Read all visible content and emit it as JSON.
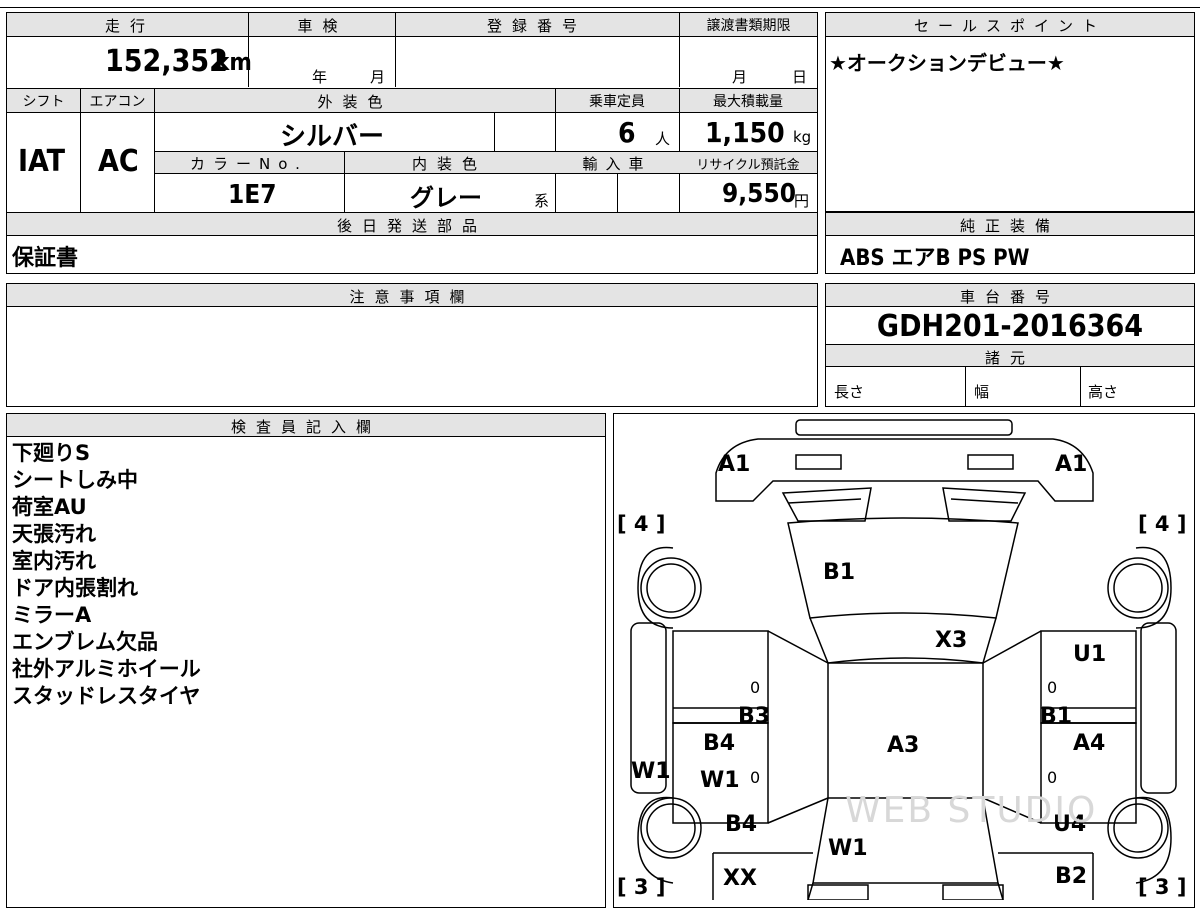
{
  "mileage": {
    "header": "走行",
    "value": "152,352",
    "unit": "km"
  },
  "shaken": {
    "header": "車検",
    "year_label": "年",
    "month_label": "月"
  },
  "registration": {
    "header": "登録番号",
    "value": ""
  },
  "transfer_deadline": {
    "header": "譲渡書類期限",
    "month_label": "月",
    "day_label": "日"
  },
  "sales_point": {
    "header": "セールスポイント",
    "text": "★オークションデビュー★"
  },
  "shift": {
    "header": "シフト",
    "value": "IAT"
  },
  "aircon": {
    "header": "エアコン",
    "value": "AC"
  },
  "exterior_color": {
    "header": "外装色",
    "value": "シルバー"
  },
  "capacity": {
    "header": "乗車定員",
    "value": "6",
    "unit": "人"
  },
  "max_load": {
    "header": "最大積載量",
    "value": "1,150",
    "unit": "kg"
  },
  "color_no": {
    "header": "カラーNo.",
    "value": "1E7"
  },
  "interior_color": {
    "header": "内装色",
    "value": "グレー",
    "suffix": "系"
  },
  "import": {
    "header": "輸入車",
    "value": ""
  },
  "recycle": {
    "header": "リサイクル預託金",
    "value": "9,550",
    "unit": "円"
  },
  "later_parts": {
    "header": "後日発送部品",
    "text": "保証書"
  },
  "genuine_equipment": {
    "header": "純正装備",
    "text": "ABS エアB PS PW"
  },
  "caution": {
    "header": "注意事項欄",
    "text": ""
  },
  "chassis": {
    "header": "車台番号",
    "value": "GDH201-2016364"
  },
  "specs": {
    "header": "諸元",
    "length_label": "長さ",
    "width_label": "幅",
    "height_label": "高さ"
  },
  "inspector": {
    "header": "検査員記入欄",
    "notes": [
      "下廻りS",
      "シートしみ中",
      "荷室AU",
      "天張汚れ",
      "室内汚れ",
      "ドア内張割れ",
      "ミラーA",
      "エンブレム欠品",
      "社外アルミホイール",
      "スタッドレスタイヤ"
    ]
  },
  "diagram": {
    "marks": {
      "a1_left": "A1",
      "a1_right": "A1",
      "tire_fl": "[ 4 ]",
      "tire_fr": "[ 4 ]",
      "b1_windshield": "B1",
      "x3": "X3",
      "u1": "U1",
      "b3": "B3",
      "b1_right": "B1",
      "b4_left_door": "B4",
      "a3": "A3",
      "a4": "A4",
      "w1_side": "W1",
      "w1_left_door": "W1",
      "b4_rear": "B4",
      "w1_rear": "W1",
      "u4": "U4",
      "xx": "XX",
      "b2": "B2",
      "tire_rl": "[ 3 ]",
      "tire_rr": "[ 3 ]",
      "zero_1": "0",
      "zero_2": "0",
      "zero_3": "0",
      "zero_4": "0"
    },
    "watermark": "WEB STUDIO"
  }
}
